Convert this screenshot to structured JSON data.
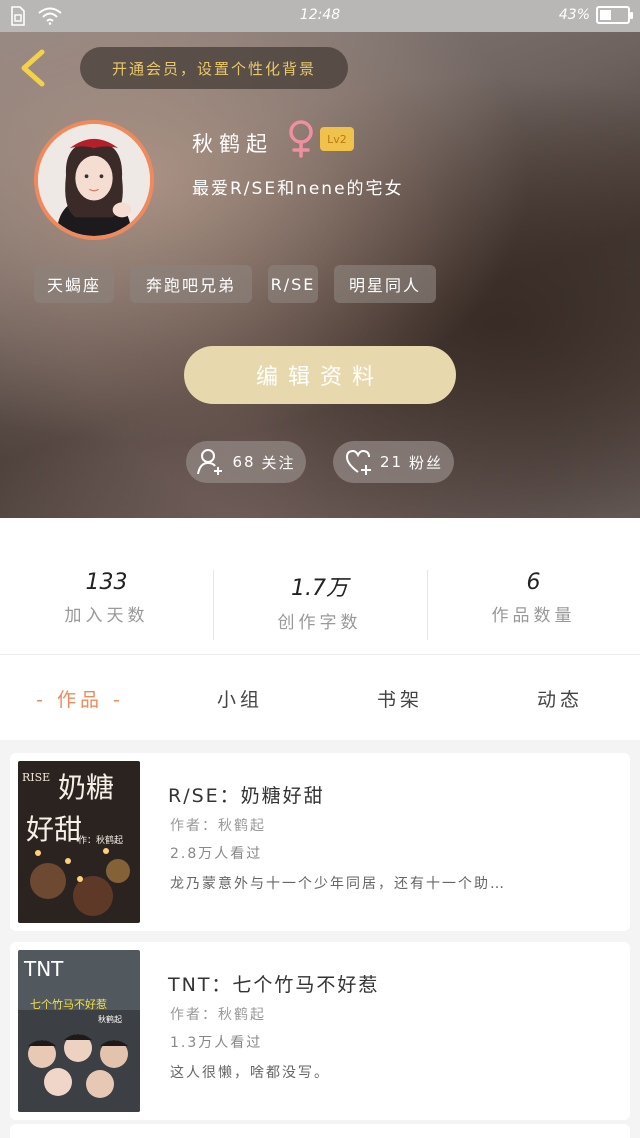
{
  "status_bar": {
    "time": "12:48",
    "battery_percent": "43%",
    "battery_level": 0.43,
    "icons": [
      "sim-icon",
      "wifi-icon",
      "battery-icon"
    ]
  },
  "header": {
    "banner_text": "开通会员，设置个性化背景",
    "name": "秋鹤起",
    "level": "Lv2",
    "bio": "最爱R/SE和nene的宅女",
    "tags": [
      "天蝎座",
      "奔跑吧兄弟",
      "R/SE",
      "明星同人"
    ],
    "edit_button": "编辑资料",
    "follow": {
      "count": "68",
      "label": "关注"
    },
    "fans": {
      "count": "21",
      "label": "粉丝"
    },
    "colors": {
      "accent": "#f08a5d",
      "banner_text": "#e9c86a",
      "edit_button": "#e7d8ad",
      "level_badge": "#f1c24b",
      "gender": "#ef8fa0"
    }
  },
  "stats": [
    {
      "value": "133",
      "label": "加入天数"
    },
    {
      "value": "1.7万",
      "label": "创作字数"
    },
    {
      "value": "6",
      "label": "作品数量"
    }
  ],
  "tabs": [
    {
      "label": "- 作品 -",
      "active": true
    },
    {
      "label": "小组",
      "active": false
    },
    {
      "label": "书架",
      "active": false
    },
    {
      "label": "动态",
      "active": false
    }
  ],
  "works": [
    {
      "title": "R/SE：奶糖好甜",
      "author": "作者：秋鹤起",
      "views": "2.8万人看过",
      "desc": "龙乃蒙意外与十一个少年同居，还有十一个助…",
      "cover_text": [
        "RISE",
        "奶糖",
        "好甜",
        "作：秋鹤起"
      ]
    },
    {
      "title": "TNT：七个竹马不好惹",
      "author": "作者：秋鹤起",
      "views": "1.3万人看过",
      "desc": "这人很懒，啥都没写。",
      "cover_text": [
        "TNT",
        "七个竹马不好惹",
        "秋鹤起"
      ]
    }
  ]
}
